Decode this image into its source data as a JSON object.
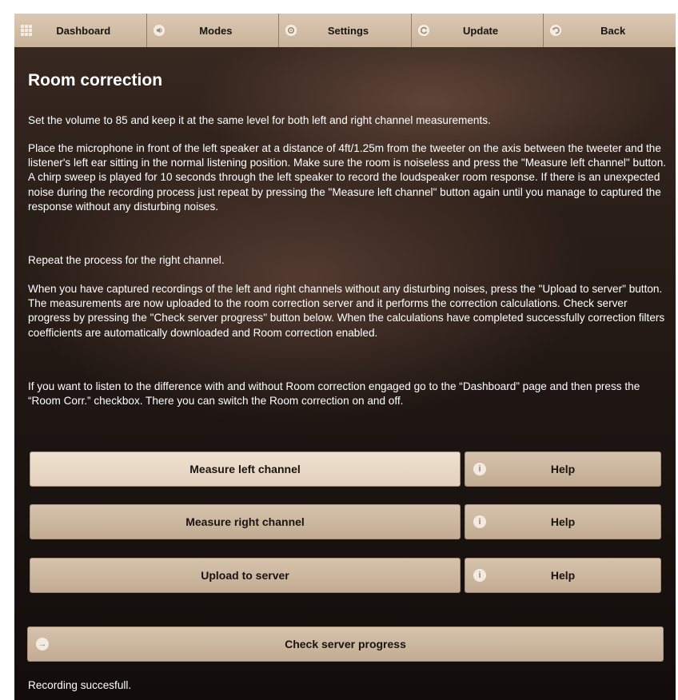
{
  "navbar": {
    "items": [
      {
        "label": "Dashboard",
        "icon": "grid-icon"
      },
      {
        "label": "Modes",
        "icon": "speaker-icon"
      },
      {
        "label": "Settings",
        "icon": "gear-icon"
      },
      {
        "label": "Update",
        "icon": "refresh-icon"
      },
      {
        "label": "Back",
        "icon": "back-arrow-icon"
      }
    ]
  },
  "page": {
    "title": "Room correction",
    "paragraphs": [
      "Set the volume to 85 and keep it at the same level for both left and right channel measurements.",
      "Place the microphone in front of the left speaker at a distance of 4ft/1.25m from the tweeter on the axis between the tweeter and the listener's left ear sitting in the normal listening position. Make sure the room is noiseless and press the \"Measure left channel\" button. A chirp sweep is played for 10 seconds through the left speaker to record the loudspeaker room response. If there is an unexpected noise during the recording process just repeat by pressing the \"Measure left channel\" button again until you manage to captured the response without any disturbing noises.",
      "Repeat the process for the right channel.",
      "When you have captured recordings of the left and right channels without any disturbing noises, press the \"Upload to server\" button. The measurements are now uploaded to the room correction server and it performs the correction calculations. Check server progress by pressing the \"Check server progress\" button below. When the calculations have completed successfully correction filters coefficients are automatically downloaded and Room correction enabled.",
      "If you want to listen to the difference with and without Room correction engaged go to the “Dashboard” page and then press the “Room Corr.” checkbox. There you can switch the Room correction on and off."
    ]
  },
  "actions": {
    "measure_left": "Measure left channel",
    "measure_right": "Measure right channel",
    "upload": "Upload to server",
    "help": "Help",
    "info_icon_glyph": "i",
    "check_progress": "Check server progress",
    "arrow_icon_glyph": "→"
  },
  "status": {
    "message": "Recording succesfull."
  },
  "colors": {
    "button_bg": "#c8b299",
    "button_active_bg": "#e8d7c4",
    "text_on_button": "#1a1410",
    "body_text": "#ffffff"
  }
}
